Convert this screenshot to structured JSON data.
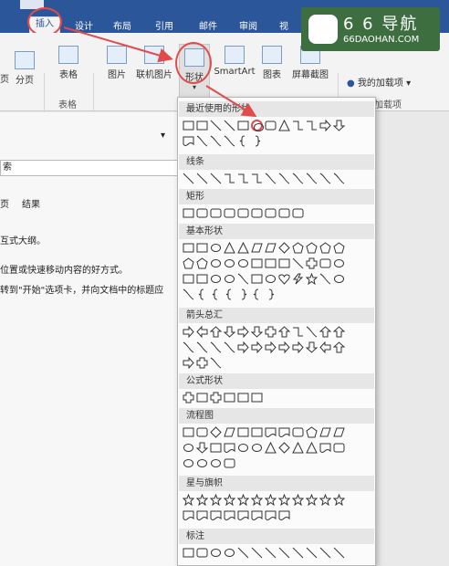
{
  "tabs": [
    "插入",
    "设计",
    "布局",
    "引用",
    "邮件",
    "审阅",
    "视"
  ],
  "ribbon": {
    "page_break": "分页",
    "page_prefix": "页",
    "table": "表格",
    "table_group": "表格",
    "picture": "图片",
    "online_picture": "联机图片",
    "shapes": "形状",
    "smartart": "SmartArt",
    "chart": "图表",
    "screenshot": "屏幕截图",
    "my_addins": "我的加载项",
    "addins_group": "加载项"
  },
  "logo": {
    "title": "6 6 导航",
    "subtitle": "66DAOHAN.COM"
  },
  "document": {
    "input": "索",
    "tab_left": "页",
    "tab_result": "结果",
    "line1": "互式大纲。",
    "line2": "位置或快速移动内容的好方式。",
    "line3": "转到\"开始\"选项卡，并向文档中的标题应"
  },
  "panel": {
    "recent": "最近使用的形状",
    "lines": "线条",
    "rectangles": "矩形",
    "basic": "基本形状",
    "arrows": "箭头总汇",
    "equation": "公式形状",
    "flowchart": "流程图",
    "stars": "星与旗帜",
    "callouts": "标注"
  }
}
